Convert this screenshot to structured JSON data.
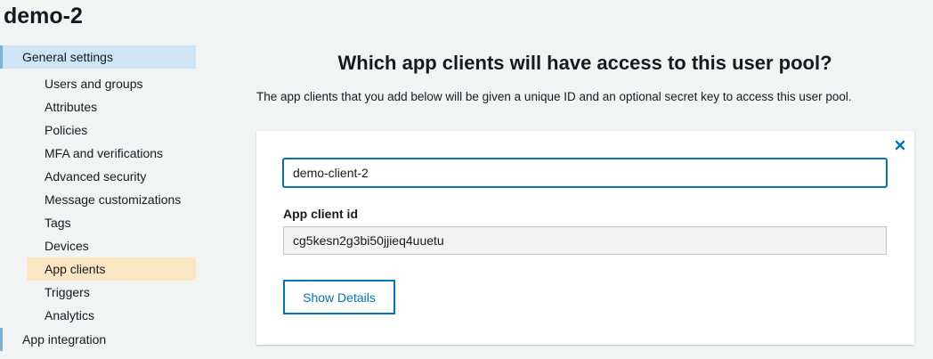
{
  "page": {
    "title": "demo-2"
  },
  "sidebar": {
    "general_settings": "General settings",
    "items": [
      {
        "label": "Users and groups"
      },
      {
        "label": "Attributes"
      },
      {
        "label": "Policies"
      },
      {
        "label": "MFA and verifications"
      },
      {
        "label": "Advanced security"
      },
      {
        "label": "Message customizations"
      },
      {
        "label": "Tags"
      },
      {
        "label": "Devices"
      },
      {
        "label": "App clients",
        "selected": true
      },
      {
        "label": "Triggers"
      },
      {
        "label": "Analytics"
      }
    ],
    "app_integration": "App integration"
  },
  "main": {
    "heading": "Which app clients will have access to this user pool?",
    "description": "The app clients that you add below will be given a unique ID and an optional secret key to access this user pool.",
    "client": {
      "name_value": "demo-client-2",
      "id_label": "App client id",
      "id_value": "cg5kesn2g3bi50jjieq4uuetu",
      "show_details_label": "Show Details"
    }
  },
  "colors": {
    "accent": "#0073bb",
    "active_section_bg": "#cfe4f5",
    "selected_item_bg": "#fbe6c4"
  }
}
